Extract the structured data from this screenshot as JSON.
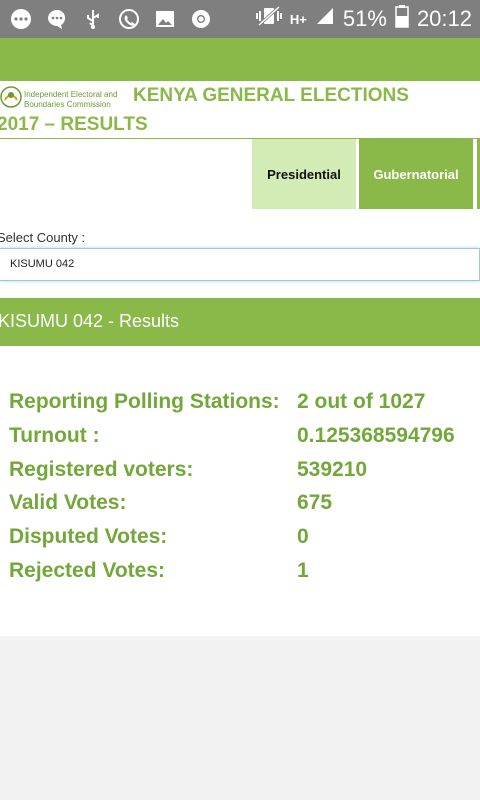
{
  "status_bar": {
    "left_icons": [
      "keyboard-icon",
      "messaging-icon",
      "usb-icon",
      "whatsapp-icon",
      "gallery-icon",
      "chrome-icon"
    ],
    "network": "H+",
    "battery": "51%",
    "time": "20:12"
  },
  "header": {
    "logo_text": "Independent Electoral and Boundaries Commission",
    "title_line1": "KENYA GENERAL ELECTIONS",
    "title_line2": "2017 – RESULTS"
  },
  "tabs": [
    {
      "label": "Presidential",
      "active": true
    },
    {
      "label": "Gubernatorial",
      "active": false
    }
  ],
  "county": {
    "label": "Select County :",
    "selected": "KISUMU 042"
  },
  "results": {
    "title": "KISUMU 042 - Results",
    "rows": [
      {
        "label": "Reporting Polling Stations:",
        "value": "2 out of 1027"
      },
      {
        "label": "Turnout :",
        "value": "0.125368594796"
      },
      {
        "label": "Registered voters:",
        "value": "539210"
      },
      {
        "label": "Valid Votes:",
        "value": "675"
      },
      {
        "label": "Disputed Votes:",
        "value": "0"
      },
      {
        "label": "Rejected Votes:",
        "value": "1"
      }
    ]
  },
  "colors": {
    "accent_green": "#8ab849",
    "active_tab": "#d3ebb5",
    "text_green": "#72a83a",
    "status_bar": "#7f7f7f"
  }
}
